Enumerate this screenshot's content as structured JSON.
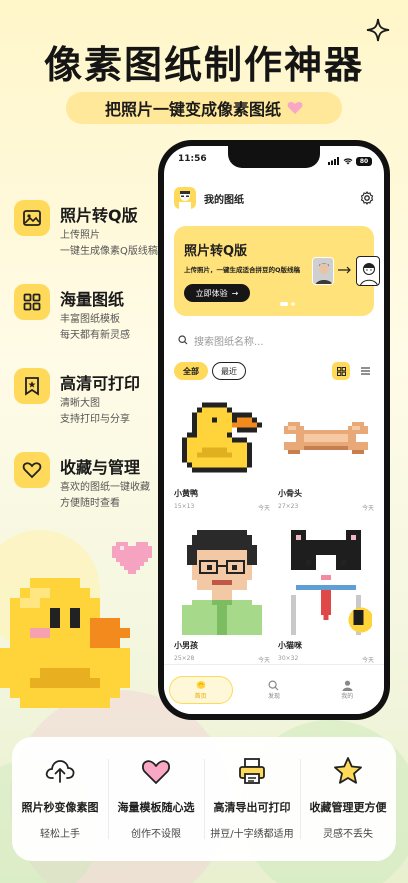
{
  "colors": {
    "accent": "#ffd95a",
    "accent_light": "#ffe27a",
    "text": "#1a1a1a"
  },
  "hero": {
    "title": "像素图纸制作神器",
    "subtitle": "把照片一键变成像素图纸"
  },
  "features": [
    {
      "icon": "image-icon",
      "title": "照片转Q版",
      "desc1": "上传照片",
      "desc2": "一键生成像素Q版线稿"
    },
    {
      "icon": "grid-icon",
      "title": "海量图纸",
      "desc1": "丰富图纸模板",
      "desc2": "每天都有新灵感"
    },
    {
      "icon": "bookmark-star-icon",
      "title": "高清可打印",
      "desc1": "清晰大图",
      "desc2": "支持打印与分享"
    },
    {
      "icon": "heart-icon",
      "title": "收藏与管理",
      "desc1": "喜欢的图纸一键收藏",
      "desc2": "方便随时查看"
    }
  ],
  "phone": {
    "time": "11:56",
    "battery": "80",
    "header_title": "我的图纸",
    "banner": {
      "title": "照片转Q版",
      "desc": "上传照片，一键生成适合拼豆的Q版线稿",
      "button": "立即体验",
      "arrow": "→"
    },
    "search_placeholder": "搜索图纸名称...",
    "filters": [
      "全部",
      "最近"
    ],
    "cards": [
      {
        "name": "小黄鸭",
        "size": "15×13",
        "date": "今天"
      },
      {
        "name": "小骨头",
        "size": "27×23",
        "date": "今天"
      },
      {
        "name": "小男孩",
        "size": "25×28",
        "date": "今天"
      },
      {
        "name": "小猫咪",
        "size": "30×32",
        "date": "今天"
      }
    ],
    "tabs": [
      {
        "label": "首页",
        "icon": "home-icon"
      },
      {
        "label": "发现",
        "icon": "search-icon"
      },
      {
        "label": "我的",
        "icon": "user-icon"
      }
    ]
  },
  "bottom_features": [
    {
      "icon": "upload-icon",
      "title": "照片秒变像素图",
      "sub": "轻松上手"
    },
    {
      "icon": "heart-icon",
      "title": "海量模板随心选",
      "sub": "创作不设限"
    },
    {
      "icon": "printer-icon",
      "title": "高清导出可打印",
      "sub": "拼豆/十字绣都适用"
    },
    {
      "icon": "star-icon",
      "title": "收藏管理更方便",
      "sub": "灵感不丢失"
    }
  ]
}
